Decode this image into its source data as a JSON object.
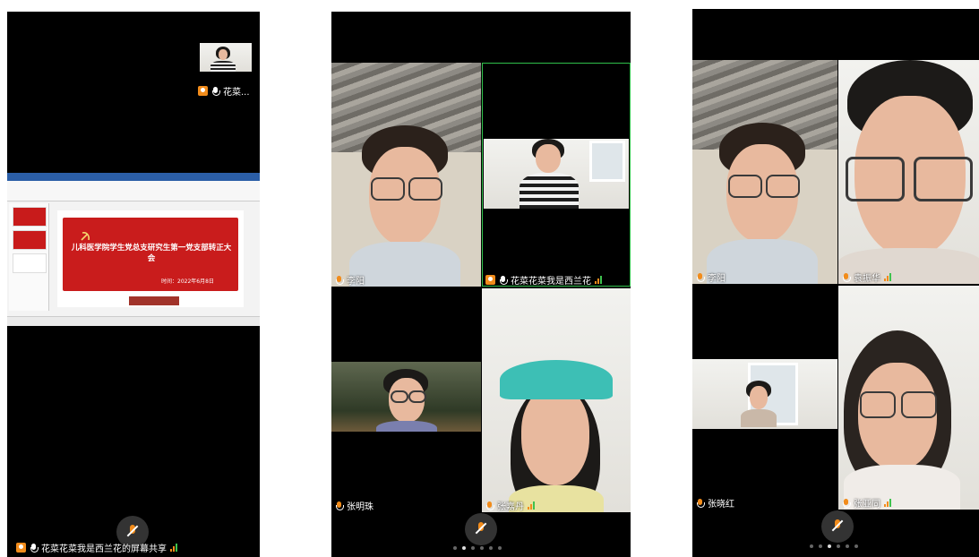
{
  "colors": {
    "accent": "#f28c1b",
    "active_border": "#2fbf4a",
    "signal_green": "#3fc24e"
  },
  "screen1": {
    "thumb_name": "花菜...",
    "presentation": {
      "title": "儿科医学院学生党总支研究生第一党支部转正大会",
      "time": "时间：2022年6月8日"
    },
    "bottom_label": "花菜花菜我是西兰花的屏幕共享"
  },
  "screen2": {
    "participants": [
      {
        "name": "李阳"
      },
      {
        "name": "花菜花菜我是西兰花"
      },
      {
        "name": "张明珠"
      },
      {
        "name": "张嘉丹"
      }
    ],
    "page_indicator": {
      "count": 6,
      "active": 1
    }
  },
  "screen3": {
    "participants": [
      {
        "name": "李阳"
      },
      {
        "name": "袁振华"
      },
      {
        "name": "张晓红"
      },
      {
        "name": "张亚同"
      }
    ],
    "page_indicator": {
      "count": 6,
      "active": 2
    }
  }
}
